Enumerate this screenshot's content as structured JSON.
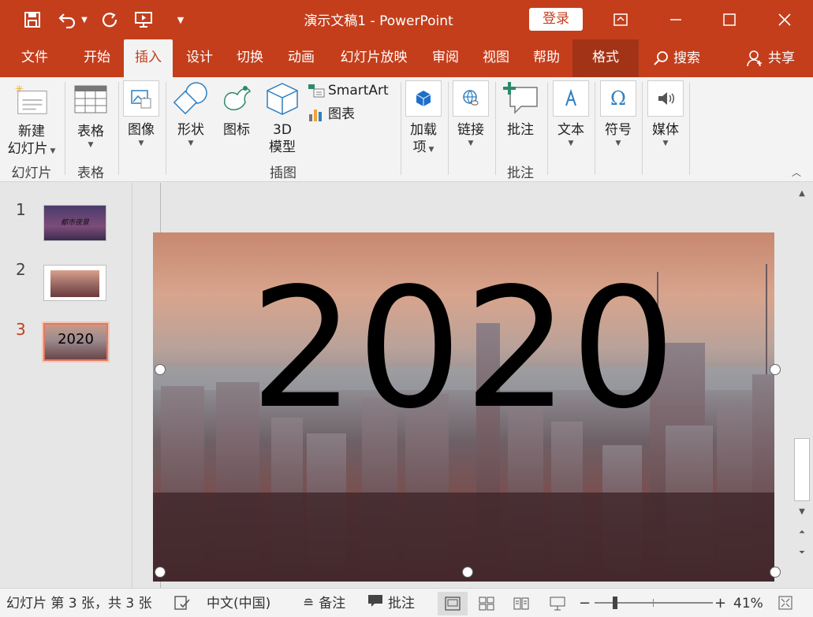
{
  "window": {
    "title": "演示文稿1  -  PowerPoint",
    "login_label": "登录"
  },
  "tabs": [
    {
      "label": "文件"
    },
    {
      "label": "开始"
    },
    {
      "label": "插入",
      "active": true
    },
    {
      "label": "设计"
    },
    {
      "label": "切换"
    },
    {
      "label": "动画"
    },
    {
      "label": "幻灯片放映"
    },
    {
      "label": "审阅"
    },
    {
      "label": "视图"
    },
    {
      "label": "帮助"
    },
    {
      "label": "格式"
    }
  ],
  "search_label": "搜索",
  "share_label": "共享",
  "ribbon": {
    "new_slide_line1": "新建",
    "new_slide_line2": "幻灯片",
    "table": "表格",
    "image": "图像",
    "shapes": "形状",
    "icons": "图标",
    "model3d_line1": "3D",
    "model3d_line2": "模型",
    "smartart": "SmartArt",
    "chart": "图表",
    "addins_line1": "加载",
    "addins_line2": "项",
    "link": "链接",
    "comment": "批注",
    "text": "文本",
    "symbol": "符号",
    "media": "媒体",
    "groups": {
      "slides": "幻灯片",
      "tables": "表格",
      "illustrations": "插图",
      "comments": "批注"
    }
  },
  "thumbnails": [
    {
      "number": "1",
      "caption": "都市夜景"
    },
    {
      "number": "2",
      "caption": ""
    },
    {
      "number": "3",
      "caption": "2020",
      "selected": true
    }
  ],
  "slide": {
    "text": "2020"
  },
  "status": {
    "slide_info": "幻灯片 第 3 张，共 3 张",
    "language": "中文(中国)",
    "notes": "备注",
    "comments": "批注",
    "zoom": "41%"
  },
  "colors": {
    "accent": "#c43e1c",
    "format_tab": "#a33316"
  }
}
